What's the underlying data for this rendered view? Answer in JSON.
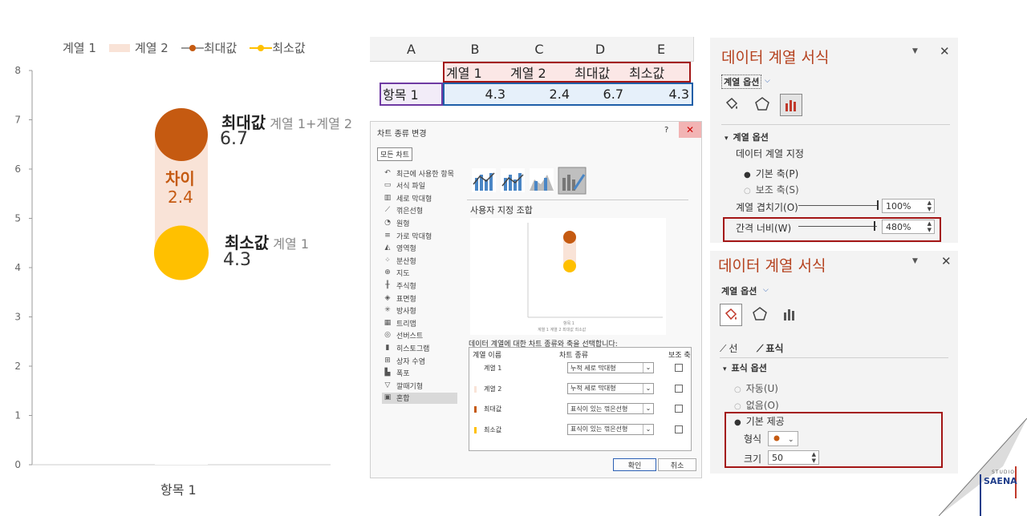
{
  "chart": {
    "legend": [
      "계열 1",
      "계열 2",
      "최대값",
      "최소값"
    ],
    "yticks": [
      "0",
      "1",
      "2",
      "3",
      "4",
      "5",
      "6",
      "7",
      "8"
    ],
    "category": "항목 1",
    "max_label": "최대값",
    "max_sub": "계열 1+계열 2",
    "max_value": "6.7",
    "diff_label": "차이",
    "diff_value": "2.4",
    "min_label": "최소값",
    "min_sub": "계열 1",
    "min_value": "4.3"
  },
  "chart_data": {
    "type": "bar",
    "categories": [
      "항목 1"
    ],
    "series": [
      {
        "name": "계열 1",
        "values": [
          4.3
        ]
      },
      {
        "name": "계열 2",
        "values": [
          2.4
        ]
      },
      {
        "name": "최대값",
        "values": [
          6.7
        ]
      },
      {
        "name": "최소값",
        "values": [
          4.3
        ]
      }
    ],
    "ylim": [
      0,
      8
    ],
    "colors": {
      "max": "#c55a11",
      "min": "#ffc000",
      "gap": "#f9e3d7"
    }
  },
  "excel": {
    "columns": [
      "A",
      "B",
      "C",
      "D",
      "E"
    ],
    "header_row": [
      "계열 1",
      "계열 2",
      "최대값",
      "최소값"
    ],
    "row_label": "항목 1",
    "row_values": [
      "4.3",
      "2.4",
      "6.7",
      "4.3"
    ]
  },
  "dialog": {
    "title": "차트 종류 변경",
    "help": "?",
    "close": "✕",
    "tab_all": "모든 차트",
    "sidebar": [
      {
        "icon": "↶",
        "label": "최근에 사용한 항목"
      },
      {
        "icon": "▭",
        "label": "서식 파일"
      },
      {
        "icon": "▥",
        "label": "세로 막대형"
      },
      {
        "icon": "⟋",
        "label": "꺾은선형"
      },
      {
        "icon": "◔",
        "label": "원형"
      },
      {
        "icon": "≡",
        "label": "가로 막대형"
      },
      {
        "icon": "◭",
        "label": "영역형"
      },
      {
        "icon": "⁘",
        "label": "분산형"
      },
      {
        "icon": "⊕",
        "label": "지도"
      },
      {
        "icon": "╫",
        "label": "주식형"
      },
      {
        "icon": "◈",
        "label": "표면형"
      },
      {
        "icon": "✳",
        "label": "방사형"
      },
      {
        "icon": "▦",
        "label": "트리맵"
      },
      {
        "icon": "◎",
        "label": "선버스트"
      },
      {
        "icon": "▮",
        "label": "히스토그램"
      },
      {
        "icon": "⊞",
        "label": "상자 수염"
      },
      {
        "icon": "▙",
        "label": "폭포"
      },
      {
        "icon": "▽",
        "label": "깔때기형"
      },
      {
        "icon": "▣",
        "label": "혼합"
      }
    ],
    "section_title": "사용자 지정 조합",
    "preview_category": "항목 1",
    "preview_legend": "계열 1  계열 2  최대값  최소값",
    "prompt": "데이터 계열에 대한 차트 종류와 축을 선택합니다:",
    "col_name": "계열 이름",
    "col_type": "차트 종류",
    "col_axis": "보조 축",
    "rows": [
      {
        "name": "계열 1",
        "type": "누적 세로 막대형",
        "color": "#ffffff"
      },
      {
        "name": "계열 2",
        "type": "누적 세로 막대형",
        "color": "#f9e3d7"
      },
      {
        "name": "최대값",
        "type": "표식이 있는 꺾은선형",
        "color": "#c55a11"
      },
      {
        "name": "최소값",
        "type": "표식이 있는 꺾은선형",
        "color": "#ffc000"
      }
    ],
    "ok": "확인",
    "cancel": "취소"
  },
  "panel1": {
    "title": "데이터 계열 서식",
    "options_dropdown": "계열 옵션",
    "section": "계열 옵션",
    "data_series_axis": "데이터 계열 지정",
    "primary_axis": "기본 축(P)",
    "secondary_axis": "보조 축(S)",
    "overlap_label": "계열 겹치기(O)",
    "overlap_value": "100%",
    "overlap_fraction": 1.0,
    "gap_label": "간격 너비(W)",
    "gap_value": "480%",
    "gap_fraction": 0.96
  },
  "panel2": {
    "title": "데이터 계열 서식",
    "options_dropdown": "계열 옵션",
    "line_tab": "선",
    "marker_tab": "표식",
    "section": "표식 옵션",
    "auto": "자동(U)",
    "none": "없음(O)",
    "builtin": "기본 제공",
    "type_label": "형식",
    "size_label": "크기",
    "size_value": "50"
  },
  "brand": {
    "studio": "STUDIO",
    "name": "SAENA"
  }
}
